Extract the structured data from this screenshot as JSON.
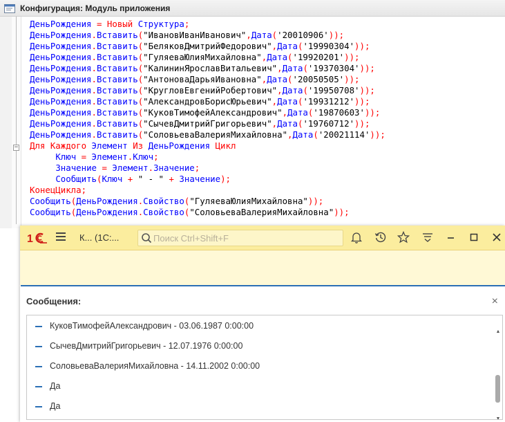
{
  "configurator": {
    "title": "Конфигурация: Модуль приложения",
    "code_lines": [
      [
        {
          "t": "ДеньРождения",
          "c": "id"
        },
        {
          "t": " = ",
          "c": "op"
        },
        {
          "t": "Новый",
          "c": "kw"
        },
        {
          "t": " ",
          "c": "str"
        },
        {
          "t": "Структура",
          "c": "id"
        },
        {
          "t": ";",
          "c": "op"
        }
      ],
      [
        {
          "t": "ДеньРождения",
          "c": "id"
        },
        {
          "t": ".",
          "c": "op"
        },
        {
          "t": "Вставить",
          "c": "id"
        },
        {
          "t": "(",
          "c": "op"
        },
        {
          "t": "\"ИвановИванИванович\"",
          "c": "str"
        },
        {
          "t": ",",
          "c": "op"
        },
        {
          "t": "Дата",
          "c": "id"
        },
        {
          "t": "(",
          "c": "op"
        },
        {
          "t": "'20010906'",
          "c": "str"
        },
        {
          "t": "));",
          "c": "op"
        }
      ],
      [
        {
          "t": "ДеньРождения",
          "c": "id"
        },
        {
          "t": ".",
          "c": "op"
        },
        {
          "t": "Вставить",
          "c": "id"
        },
        {
          "t": "(",
          "c": "op"
        },
        {
          "t": "\"БеляковДмитрийФедорович\"",
          "c": "str"
        },
        {
          "t": ",",
          "c": "op"
        },
        {
          "t": "Дата",
          "c": "id"
        },
        {
          "t": "(",
          "c": "op"
        },
        {
          "t": "'19990304'",
          "c": "str"
        },
        {
          "t": "));",
          "c": "op"
        }
      ],
      [
        {
          "t": "ДеньРождения",
          "c": "id"
        },
        {
          "t": ".",
          "c": "op"
        },
        {
          "t": "Вставить",
          "c": "id"
        },
        {
          "t": "(",
          "c": "op"
        },
        {
          "t": "\"ГуляеваЮлияМихайловна\"",
          "c": "str"
        },
        {
          "t": ",",
          "c": "op"
        },
        {
          "t": "Дата",
          "c": "id"
        },
        {
          "t": "(",
          "c": "op"
        },
        {
          "t": "'19920201'",
          "c": "str"
        },
        {
          "t": "));",
          "c": "op"
        }
      ],
      [
        {
          "t": "ДеньРождения",
          "c": "id"
        },
        {
          "t": ".",
          "c": "op"
        },
        {
          "t": "Вставить",
          "c": "id"
        },
        {
          "t": "(",
          "c": "op"
        },
        {
          "t": "\"КалининЯрославВитальевич\"",
          "c": "str"
        },
        {
          "t": ",",
          "c": "op"
        },
        {
          "t": "Дата",
          "c": "id"
        },
        {
          "t": "(",
          "c": "op"
        },
        {
          "t": "'19370304'",
          "c": "str"
        },
        {
          "t": "));",
          "c": "op"
        }
      ],
      [
        {
          "t": "ДеньРождения",
          "c": "id"
        },
        {
          "t": ".",
          "c": "op"
        },
        {
          "t": "Вставить",
          "c": "id"
        },
        {
          "t": "(",
          "c": "op"
        },
        {
          "t": "\"АнтоноваДарьяИвановна\"",
          "c": "str"
        },
        {
          "t": ",",
          "c": "op"
        },
        {
          "t": "Дата",
          "c": "id"
        },
        {
          "t": "(",
          "c": "op"
        },
        {
          "t": "'20050505'",
          "c": "str"
        },
        {
          "t": "));",
          "c": "op"
        }
      ],
      [
        {
          "t": "ДеньРождения",
          "c": "id"
        },
        {
          "t": ".",
          "c": "op"
        },
        {
          "t": "Вставить",
          "c": "id"
        },
        {
          "t": "(",
          "c": "op"
        },
        {
          "t": "\"КругловЕвгенийРобертович\"",
          "c": "str"
        },
        {
          "t": ",",
          "c": "op"
        },
        {
          "t": "Дата",
          "c": "id"
        },
        {
          "t": "(",
          "c": "op"
        },
        {
          "t": "'19950708'",
          "c": "str"
        },
        {
          "t": "));",
          "c": "op"
        }
      ],
      [
        {
          "t": "ДеньРождения",
          "c": "id"
        },
        {
          "t": ".",
          "c": "op"
        },
        {
          "t": "Вставить",
          "c": "id"
        },
        {
          "t": "(",
          "c": "op"
        },
        {
          "t": "\"АлександровБорисЮрьевич\"",
          "c": "str"
        },
        {
          "t": ",",
          "c": "op"
        },
        {
          "t": "Дата",
          "c": "id"
        },
        {
          "t": "(",
          "c": "op"
        },
        {
          "t": "'19931212'",
          "c": "str"
        },
        {
          "t": "));",
          "c": "op"
        }
      ],
      [
        {
          "t": "ДеньРождения",
          "c": "id"
        },
        {
          "t": ".",
          "c": "op"
        },
        {
          "t": "Вставить",
          "c": "id"
        },
        {
          "t": "(",
          "c": "op"
        },
        {
          "t": "\"КуковТимофейАлександрович\"",
          "c": "str"
        },
        {
          "t": ",",
          "c": "op"
        },
        {
          "t": "Дата",
          "c": "id"
        },
        {
          "t": "(",
          "c": "op"
        },
        {
          "t": "'19870603'",
          "c": "str"
        },
        {
          "t": "));",
          "c": "op"
        }
      ],
      [
        {
          "t": "ДеньРождения",
          "c": "id"
        },
        {
          "t": ".",
          "c": "op"
        },
        {
          "t": "Вставить",
          "c": "id"
        },
        {
          "t": "(",
          "c": "op"
        },
        {
          "t": "\"СычевДмитрийГригорьевич\"",
          "c": "str"
        },
        {
          "t": ",",
          "c": "op"
        },
        {
          "t": "Дата",
          "c": "id"
        },
        {
          "t": "(",
          "c": "op"
        },
        {
          "t": "'19760712'",
          "c": "str"
        },
        {
          "t": "));",
          "c": "op"
        }
      ],
      [
        {
          "t": "ДеньРождения",
          "c": "id"
        },
        {
          "t": ".",
          "c": "op"
        },
        {
          "t": "Вставить",
          "c": "id"
        },
        {
          "t": "(",
          "c": "op"
        },
        {
          "t": "\"СоловьеваВалерияМихайловна\"",
          "c": "str"
        },
        {
          "t": ",",
          "c": "op"
        },
        {
          "t": "Дата",
          "c": "id"
        },
        {
          "t": "(",
          "c": "op"
        },
        {
          "t": "'20021114'",
          "c": "str"
        },
        {
          "t": "));",
          "c": "op"
        }
      ],
      [
        {
          "t": "Для Каждого ",
          "c": "kw"
        },
        {
          "t": "Элемент",
          "c": "id"
        },
        {
          "t": " Из ",
          "c": "kw"
        },
        {
          "t": "ДеньРождения",
          "c": "id"
        },
        {
          "t": " Цикл",
          "c": "kw"
        }
      ],
      [
        {
          "t": "     ",
          "c": "str"
        },
        {
          "t": "Ключ",
          "c": "id"
        },
        {
          "t": " = ",
          "c": "op"
        },
        {
          "t": "Элемент",
          "c": "id"
        },
        {
          "t": ".",
          "c": "op"
        },
        {
          "t": "Ключ",
          "c": "id"
        },
        {
          "t": ";",
          "c": "op"
        }
      ],
      [
        {
          "t": "     ",
          "c": "str"
        },
        {
          "t": "Значение",
          "c": "id"
        },
        {
          "t": " = ",
          "c": "op"
        },
        {
          "t": "Элемент",
          "c": "id"
        },
        {
          "t": ".",
          "c": "op"
        },
        {
          "t": "Значение",
          "c": "id"
        },
        {
          "t": ";",
          "c": "op"
        }
      ],
      [
        {
          "t": "     ",
          "c": "str"
        },
        {
          "t": "Сообщить",
          "c": "id"
        },
        {
          "t": "(",
          "c": "op"
        },
        {
          "t": "Ключ",
          "c": "id"
        },
        {
          "t": " + ",
          "c": "op"
        },
        {
          "t": "\" - \"",
          "c": "str"
        },
        {
          "t": " + ",
          "c": "op"
        },
        {
          "t": "Значение",
          "c": "id"
        },
        {
          "t": ");",
          "c": "op"
        }
      ],
      [
        {
          "t": "КонецЦикла",
          "c": "kw"
        },
        {
          "t": ";",
          "c": "op"
        }
      ],
      [
        {
          "t": "Сообщить",
          "c": "id"
        },
        {
          "t": "(",
          "c": "op"
        },
        {
          "t": "ДеньРождения",
          "c": "id"
        },
        {
          "t": ".",
          "c": "op"
        },
        {
          "t": "Свойство",
          "c": "id"
        },
        {
          "t": "(",
          "c": "op"
        },
        {
          "t": "\"ГуляеваЮлияМихайловна\"",
          "c": "str"
        },
        {
          "t": "));",
          "c": "op"
        }
      ],
      [
        {
          "t": "Сообщить",
          "c": "id"
        },
        {
          "t": "(",
          "c": "op"
        },
        {
          "t": "ДеньРождения",
          "c": "id"
        },
        {
          "t": ".",
          "c": "op"
        },
        {
          "t": "Свойство",
          "c": "id"
        },
        {
          "t": "(",
          "c": "op"
        },
        {
          "t": "\"СоловьеваВалерияМихайловна\"",
          "c": "str"
        },
        {
          "t": "));",
          "c": "op"
        }
      ]
    ]
  },
  "client": {
    "window_title": "К...  (1С:...",
    "search_placeholder": "Поиск Ctrl+Shift+F",
    "icons": {
      "logo": "1c-logo",
      "menu": "hamburger-menu-icon",
      "bell": "bell-icon",
      "history": "history-icon",
      "favorite": "star-icon",
      "settings": "panel-settings-icon",
      "minimize": "minimize-icon",
      "maximize": "maximize-icon",
      "close": "close-icon"
    },
    "colors": {
      "topbar": "#fbed9e",
      "accent": "#2a6fb5",
      "keyword": "#ff0000",
      "identifier": "#0000ff"
    }
  },
  "messages": {
    "header": "Сообщения:",
    "close_glyph": "×",
    "items": [
      "КуковТимофейАлександрович - 03.06.1987 0:00:00",
      "СычевДмитрийГригорьевич - 12.07.1976 0:00:00",
      "СоловьеваВалерияМихайловна - 14.11.2002 0:00:00",
      "Да",
      "Да"
    ]
  }
}
